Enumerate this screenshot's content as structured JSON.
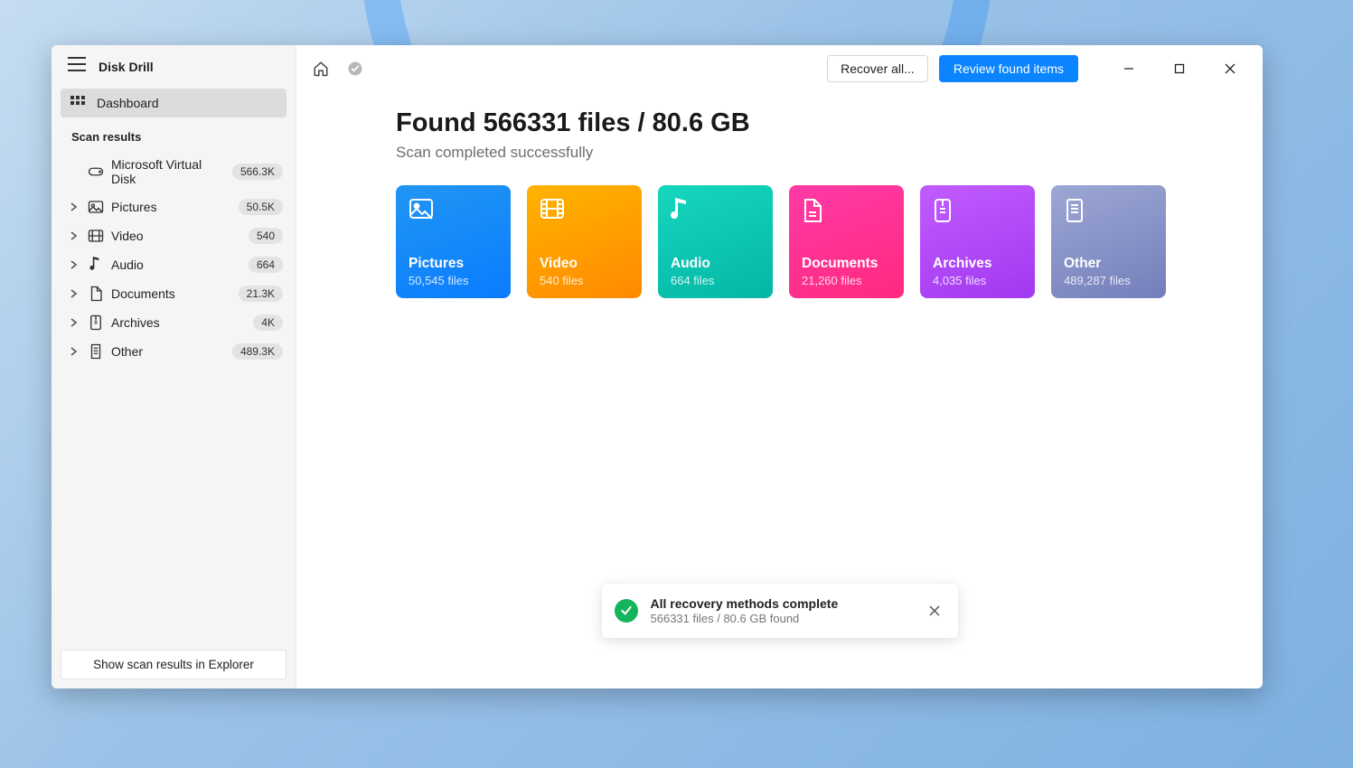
{
  "app": {
    "title": "Disk Drill"
  },
  "sidebar": {
    "dashboard_label": "Dashboard",
    "section_label": "Scan results",
    "items": [
      {
        "label": "Microsoft Virtual Disk",
        "count": "566.3K",
        "icon": "disk"
      },
      {
        "label": "Pictures",
        "count": "50.5K",
        "icon": "image",
        "expandable": true
      },
      {
        "label": "Video",
        "count": "540",
        "icon": "film",
        "expandable": true
      },
      {
        "label": "Audio",
        "count": "664",
        "icon": "note",
        "expandable": true
      },
      {
        "label": "Documents",
        "count": "21.3K",
        "icon": "doc",
        "expandable": true
      },
      {
        "label": "Archives",
        "count": "4K",
        "icon": "zip",
        "expandable": true
      },
      {
        "label": "Other",
        "count": "489.3K",
        "icon": "page",
        "expandable": true
      }
    ],
    "footer_button": "Show scan results in Explorer"
  },
  "toolbar": {
    "recover_label": "Recover all...",
    "review_label": "Review found items"
  },
  "main": {
    "headline": "Found 566331 files / 80.6 GB",
    "subhead": "Scan completed successfully",
    "cards": [
      {
        "title": "Pictures",
        "sub": "50,545 files"
      },
      {
        "title": "Video",
        "sub": "540 files"
      },
      {
        "title": "Audio",
        "sub": "664 files"
      },
      {
        "title": "Documents",
        "sub": "21,260 files"
      },
      {
        "title": "Archives",
        "sub": "4,035 files"
      },
      {
        "title": "Other",
        "sub": "489,287 files"
      }
    ]
  },
  "toast": {
    "title": "All recovery methods complete",
    "sub": "566331 files / 80.6 GB found"
  }
}
